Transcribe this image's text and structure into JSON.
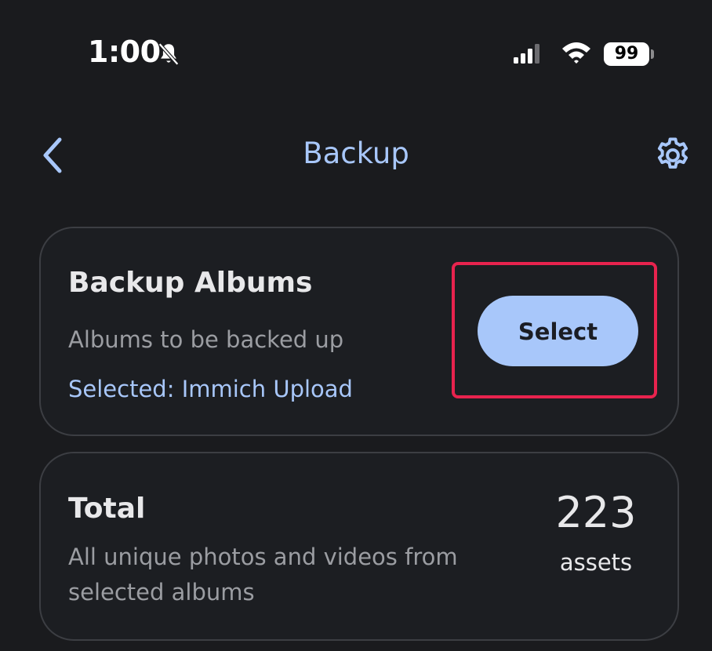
{
  "status_bar": {
    "time": "1:00",
    "battery": "99",
    "icons": [
      "bell-slash-icon",
      "cellular-signal-icon",
      "wifi-icon",
      "battery-icon"
    ]
  },
  "app_bar": {
    "title": "Backup",
    "back_icon": "chevron-left-icon",
    "settings_icon": "gear-icon"
  },
  "backup_albums_card": {
    "title": "Backup Albums",
    "description": "Albums to be backed up",
    "selected_text": "Selected: Immich Upload",
    "select_button_label": "Select"
  },
  "total_card": {
    "title": "Total",
    "description_line1": "All unique photos and videos from",
    "description_line2": "selected albums",
    "count": "223",
    "count_unit": "assets"
  },
  "colors": {
    "background": "#1a1b1e",
    "accent": "#a8c7fa",
    "highlight": "#e8234e",
    "card_border": "#3c3e43"
  }
}
